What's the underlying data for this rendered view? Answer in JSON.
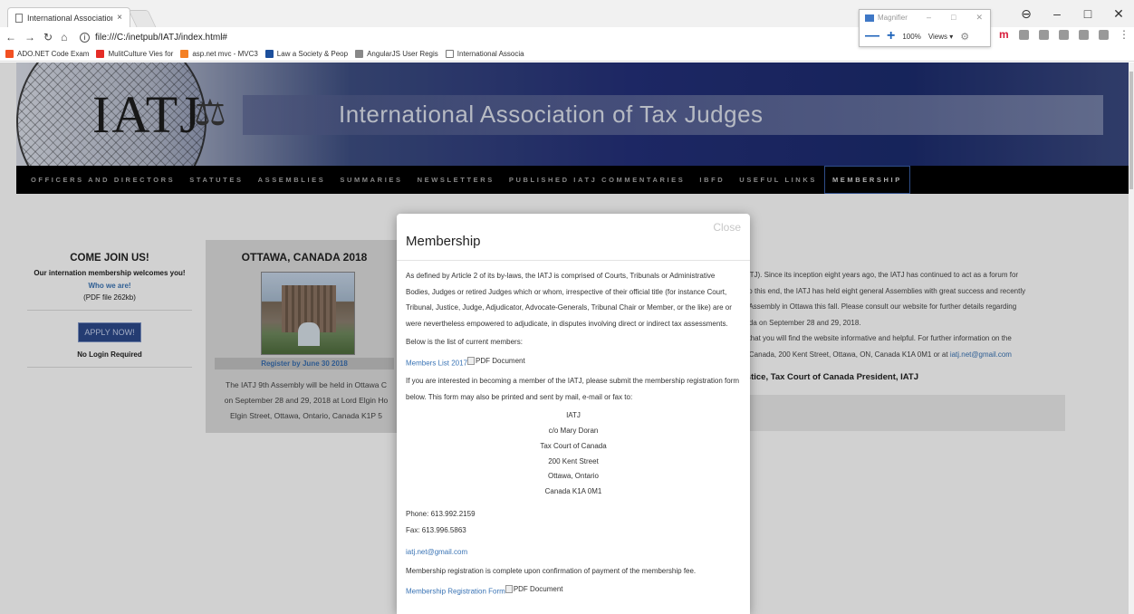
{
  "browser": {
    "tab_title": "International Association",
    "tab_close": "×",
    "address": "file:///C:/inetpub/IATJ/index.html#",
    "info_icon": "i",
    "window_buttons": [
      "⊖",
      "–",
      "□",
      "✕"
    ],
    "bookmarks": [
      {
        "label": "ADO.NET Code Exam",
        "color": "#f25022"
      },
      {
        "label": "MulitCulture Vies for",
        "color": "#e52d27"
      },
      {
        "label": "asp.net mvc - MVC3",
        "color": "#f48024"
      },
      {
        "label": "Law a Society & Peop",
        "color": "#1c4f9c"
      },
      {
        "label": "AngularJS User Regis",
        "color": "#888888"
      },
      {
        "label": "International Associa",
        "color": "#777777"
      }
    ]
  },
  "magnifier": {
    "title": "Magnifier",
    "controls": [
      "–",
      "□",
      "✕"
    ],
    "minus": "—",
    "plus": "+",
    "zoom": "100%",
    "views": "Views ▾"
  },
  "site": {
    "logo": "IATJ",
    "title": "International Association of Tax Judges",
    "nav": [
      {
        "label": "OFFICERS AND DIRECTORS",
        "active": false
      },
      {
        "label": "STATUTES",
        "active": false
      },
      {
        "label": "ASSEMBLIES",
        "active": false
      },
      {
        "label": "SUMMARIES",
        "active": false
      },
      {
        "label": "NEWSLETTERS",
        "active": false
      },
      {
        "label": "PUBLISHED IATJ COMMENTARIES",
        "active": false
      },
      {
        "label": "IBFD",
        "active": false
      },
      {
        "label": "USEFUL LINKS",
        "active": false
      },
      {
        "label": "MEMBERSHIP",
        "active": true
      }
    ]
  },
  "sidebar": {
    "heading": "COME JOIN US!",
    "welcome": "Our internation membership welcomes you!",
    "who_link": "Who we are!",
    "pdf_size": "(PDF file 262kb)",
    "apply_button": "APPLY NOW!",
    "no_login": "No Login Required"
  },
  "event": {
    "heading": "OTTAWA, CANADA 2018",
    "register": "Register by June 30 2018",
    "desc_lines": [
      "The IATJ 9th Assembly will be held in Ottawa C",
      "on September 28 and 29, 2018 at Lord Elgin Ho",
      "Elgin Street, Ottawa, Ontario, Canada K1P 5"
    ]
  },
  "right": {
    "lines": [
      "(IATJ). Since its inception eight years ago, the IATJ has continued to act as a forum for",
      ". To this end, the IATJ has held eight general Assemblies with great success and recently",
      "th Assembly in Ottawa this fall. Please consult our website for further details regarding",
      "nada on September 28 and 29, 2018."
    ],
    "lines2": [
      "ul that you will find the website informative and helpful. For further information on the",
      "of Canada, 200 Kent Street, Ottawa, ON, Canada K1A 0M1 or at "
    ],
    "email": "iatj.net@gmail.com",
    "signature": "ustice, Tax Court of Canada President, IATJ"
  },
  "modal": {
    "title": "Membership",
    "close": "Close",
    "intro": "As defined by Article 2 of its by-laws, the IATJ is comprised of Courts, Tribunals or Administrative Bodies, Judges or retired Judges which or whom, irrespective of their official title (for instance Court, Tribunal, Justice, Judge, Adjudicator, Advocate-Generals, Tribunal Chair or Member, or the like) are or were nevertheless empowered to adjudicate, in disputes involving direct or indirect tax assessments.",
    "list_intro": "Below is the list of current members:",
    "members_link": "Members List 2017",
    "pdf_alt": "PDF Document",
    "submit_text": "If you are interested in becoming a member of the IATJ, please submit the membership registration form below. This form may also be printed and sent by mail, e-mail or fax to:",
    "address": [
      "IATJ",
      "c/o Mary Doran",
      "Tax Court of Canada",
      "200 Kent Street",
      "Ottawa, Ontario",
      "Canada K1A 0M1"
    ],
    "phone": "Phone: 613.992.2159",
    "fax": "Fax: 613.996.5863",
    "email": "iatj.net@gmail.com",
    "complete_text": "Membership registration is complete upon confirmation of payment of the membership fee.",
    "form_link": "Membership Registration Form",
    "form_pdf_alt": "PDF Document"
  }
}
